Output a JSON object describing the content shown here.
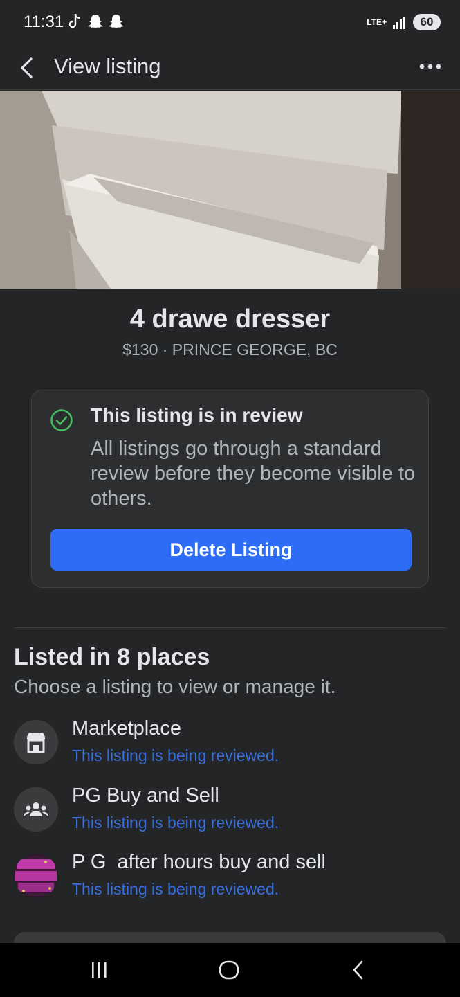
{
  "status_bar": {
    "time": "11:31",
    "network": "LTE+",
    "battery": "60",
    "app_icons": [
      "tiktok-icon",
      "snapchat-icon",
      "snapchat-icon"
    ]
  },
  "header": {
    "title": "View listing"
  },
  "listing": {
    "title": "4 drawe dresser",
    "price_location": "$130 · PRINCE GEORGE, BC"
  },
  "review_notice": {
    "title": "This listing is in review",
    "body": "All listings go through a standard review before they become visible to others.",
    "delete_label": "Delete Listing"
  },
  "places": {
    "title": "Listed in 8 places",
    "subtitle": "Choose a listing to view or manage it.",
    "items": [
      {
        "name": "Marketplace",
        "status": "This listing is being reviewed.",
        "icon": "marketplace-store-icon"
      },
      {
        "name": "PG Buy and Sell",
        "status": "This listing is being reviewed.",
        "icon": "group-icon"
      },
      {
        "name": "P G  after hours buy and sell",
        "status": "This listing is being reviewed.",
        "icon": "group-avatar"
      }
    ]
  },
  "colors": {
    "accent": "#2d6cf5",
    "status_link": "#3a6fe0",
    "success": "#45bd62",
    "background": "#242526"
  }
}
